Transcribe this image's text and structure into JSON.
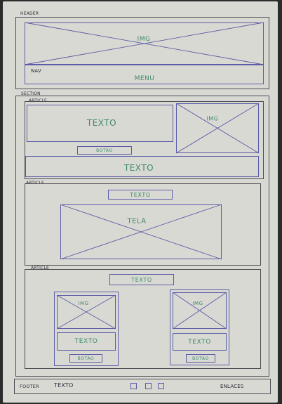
{
  "header": {
    "label": "HEADER",
    "img": "IMG",
    "nav": "NAV",
    "menu": "MENU"
  },
  "section": {
    "label": "SECTION"
  },
  "article1": {
    "label": "ARTICLE",
    "texto": "TEXTO",
    "img": "IMG",
    "button": "BOTÃO",
    "texto2": "TEXTO"
  },
  "article2": {
    "label": "ARTICLE",
    "texto": "TEXTO",
    "tela": "TELA"
  },
  "article3": {
    "label": "ARTICLE",
    "texto": "TEXTO",
    "card_left": {
      "img": "IMG",
      "texto": "TEXTO",
      "button": "BOTÃO"
    },
    "card_right": {
      "img": "IMG",
      "texto": "TEXTO",
      "button": "BOTÃO"
    }
  },
  "footer": {
    "label": "FOOTER",
    "texto": "TEXTO",
    "links": "ENLACES"
  }
}
